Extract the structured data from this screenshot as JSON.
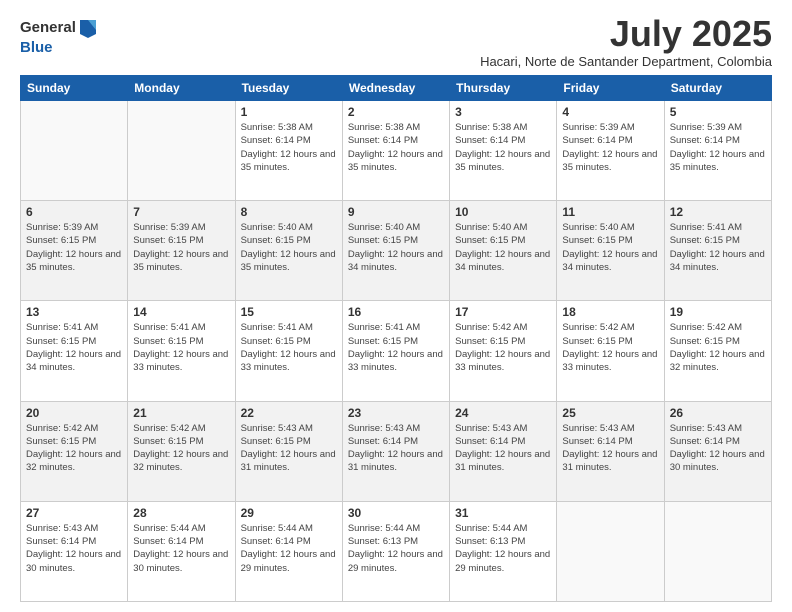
{
  "header": {
    "logo_line1": "General",
    "logo_line2": "Blue",
    "month_year": "July 2025",
    "location": "Hacari, Norte de Santander Department, Colombia"
  },
  "days_of_week": [
    "Sunday",
    "Monday",
    "Tuesday",
    "Wednesday",
    "Thursday",
    "Friday",
    "Saturday"
  ],
  "weeks": [
    [
      {
        "day": "",
        "info": ""
      },
      {
        "day": "",
        "info": ""
      },
      {
        "day": "1",
        "info": "Sunrise: 5:38 AM\nSunset: 6:14 PM\nDaylight: 12 hours and 35 minutes."
      },
      {
        "day": "2",
        "info": "Sunrise: 5:38 AM\nSunset: 6:14 PM\nDaylight: 12 hours and 35 minutes."
      },
      {
        "day": "3",
        "info": "Sunrise: 5:38 AM\nSunset: 6:14 PM\nDaylight: 12 hours and 35 minutes."
      },
      {
        "day": "4",
        "info": "Sunrise: 5:39 AM\nSunset: 6:14 PM\nDaylight: 12 hours and 35 minutes."
      },
      {
        "day": "5",
        "info": "Sunrise: 5:39 AM\nSunset: 6:14 PM\nDaylight: 12 hours and 35 minutes."
      }
    ],
    [
      {
        "day": "6",
        "info": "Sunrise: 5:39 AM\nSunset: 6:15 PM\nDaylight: 12 hours and 35 minutes."
      },
      {
        "day": "7",
        "info": "Sunrise: 5:39 AM\nSunset: 6:15 PM\nDaylight: 12 hours and 35 minutes."
      },
      {
        "day": "8",
        "info": "Sunrise: 5:40 AM\nSunset: 6:15 PM\nDaylight: 12 hours and 35 minutes."
      },
      {
        "day": "9",
        "info": "Sunrise: 5:40 AM\nSunset: 6:15 PM\nDaylight: 12 hours and 34 minutes."
      },
      {
        "day": "10",
        "info": "Sunrise: 5:40 AM\nSunset: 6:15 PM\nDaylight: 12 hours and 34 minutes."
      },
      {
        "day": "11",
        "info": "Sunrise: 5:40 AM\nSunset: 6:15 PM\nDaylight: 12 hours and 34 minutes."
      },
      {
        "day": "12",
        "info": "Sunrise: 5:41 AM\nSunset: 6:15 PM\nDaylight: 12 hours and 34 minutes."
      }
    ],
    [
      {
        "day": "13",
        "info": "Sunrise: 5:41 AM\nSunset: 6:15 PM\nDaylight: 12 hours and 34 minutes."
      },
      {
        "day": "14",
        "info": "Sunrise: 5:41 AM\nSunset: 6:15 PM\nDaylight: 12 hours and 33 minutes."
      },
      {
        "day": "15",
        "info": "Sunrise: 5:41 AM\nSunset: 6:15 PM\nDaylight: 12 hours and 33 minutes."
      },
      {
        "day": "16",
        "info": "Sunrise: 5:41 AM\nSunset: 6:15 PM\nDaylight: 12 hours and 33 minutes."
      },
      {
        "day": "17",
        "info": "Sunrise: 5:42 AM\nSunset: 6:15 PM\nDaylight: 12 hours and 33 minutes."
      },
      {
        "day": "18",
        "info": "Sunrise: 5:42 AM\nSunset: 6:15 PM\nDaylight: 12 hours and 33 minutes."
      },
      {
        "day": "19",
        "info": "Sunrise: 5:42 AM\nSunset: 6:15 PM\nDaylight: 12 hours and 32 minutes."
      }
    ],
    [
      {
        "day": "20",
        "info": "Sunrise: 5:42 AM\nSunset: 6:15 PM\nDaylight: 12 hours and 32 minutes."
      },
      {
        "day": "21",
        "info": "Sunrise: 5:42 AM\nSunset: 6:15 PM\nDaylight: 12 hours and 32 minutes."
      },
      {
        "day": "22",
        "info": "Sunrise: 5:43 AM\nSunset: 6:15 PM\nDaylight: 12 hours and 31 minutes."
      },
      {
        "day": "23",
        "info": "Sunrise: 5:43 AM\nSunset: 6:14 PM\nDaylight: 12 hours and 31 minutes."
      },
      {
        "day": "24",
        "info": "Sunrise: 5:43 AM\nSunset: 6:14 PM\nDaylight: 12 hours and 31 minutes."
      },
      {
        "day": "25",
        "info": "Sunrise: 5:43 AM\nSunset: 6:14 PM\nDaylight: 12 hours and 31 minutes."
      },
      {
        "day": "26",
        "info": "Sunrise: 5:43 AM\nSunset: 6:14 PM\nDaylight: 12 hours and 30 minutes."
      }
    ],
    [
      {
        "day": "27",
        "info": "Sunrise: 5:43 AM\nSunset: 6:14 PM\nDaylight: 12 hours and 30 minutes."
      },
      {
        "day": "28",
        "info": "Sunrise: 5:44 AM\nSunset: 6:14 PM\nDaylight: 12 hours and 30 minutes."
      },
      {
        "day": "29",
        "info": "Sunrise: 5:44 AM\nSunset: 6:14 PM\nDaylight: 12 hours and 29 minutes."
      },
      {
        "day": "30",
        "info": "Sunrise: 5:44 AM\nSunset: 6:13 PM\nDaylight: 12 hours and 29 minutes."
      },
      {
        "day": "31",
        "info": "Sunrise: 5:44 AM\nSunset: 6:13 PM\nDaylight: 12 hours and 29 minutes."
      },
      {
        "day": "",
        "info": ""
      },
      {
        "day": "",
        "info": ""
      }
    ]
  ]
}
